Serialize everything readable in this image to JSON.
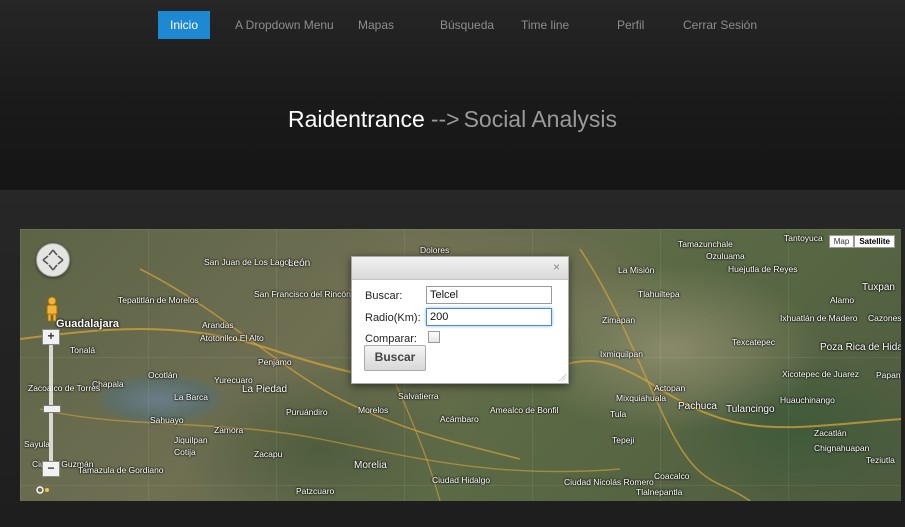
{
  "nav": {
    "items": [
      {
        "label": "Inicio",
        "active": true
      },
      {
        "label": "A Dropdown Menu"
      },
      {
        "label": "Mapas"
      },
      {
        "label": "Búsqueda"
      },
      {
        "label": "Time line"
      },
      {
        "label": "Perfil"
      },
      {
        "label": "Cerrar Sesión"
      }
    ],
    "accent": "#1e88d2"
  },
  "hero": {
    "brand": "Raidentrance",
    "arrow": "-->",
    "subtitle": "Social Analysis"
  },
  "map": {
    "type_buttons": {
      "map": "Map",
      "satellite": "Satellite",
      "selected": "Satellite"
    },
    "zoom_in": "+",
    "zoom_out": "−",
    "labels": [
      "Guadalajara",
      "Tonalá",
      "Tepatitlán de Morelos",
      "Arandas",
      "San Juan de Los Lagos",
      "León",
      "San Francisco del Rincón",
      "Dolores",
      "Atotonilco El Alto",
      "Penjamo",
      "Ocotlán",
      "Chapala",
      "La Barca",
      "La Piedad",
      "Yurecuaro",
      "Sahuayo",
      "Jiquilpan",
      "Zamora",
      "Puruándiro",
      "Morelos",
      "Salvatierra",
      "Acámbaro",
      "Morelia",
      "Ciudad Hidalgo",
      "Zacapu",
      "Cotija",
      "Tamazula de Gordiano",
      "Patzcuaro",
      "Amealco de Bonfil",
      "Tamazunchale",
      "Ozuluama",
      "Huejutla de Reyes",
      "Tantoyuca",
      "Tuxpan",
      "Ixhuatlán de Madero",
      "Poza Rica de Hidalgo",
      "Xicotepec de Juarez",
      "Huauchinango",
      "Tlahuiltepa",
      "La Misión",
      "Zimapan",
      "Ixmiquilpan",
      "Actopan",
      "Pachuca",
      "Tulancingo",
      "Zacatlán",
      "Chignahuapan",
      "Mixquiahuala",
      "Tula",
      "Tepeji",
      "Coacalco",
      "Ciudad Nicolás Romero",
      "Tlalnepantla",
      "Teziutla",
      "Papantla",
      "Alamo",
      "Cazones de Herrera",
      "Texcatepec",
      "Sayula",
      "Ciudad Guzmán",
      "Zacoalco de Torres"
    ]
  },
  "dialog": {
    "close": "×",
    "search_label": "Buscar:",
    "search_value": "Telcel",
    "radius_label": "Radio(Km):",
    "radius_value": "200",
    "compare_label": "Comparar:",
    "compare_checked": false,
    "submit": "Buscar"
  }
}
